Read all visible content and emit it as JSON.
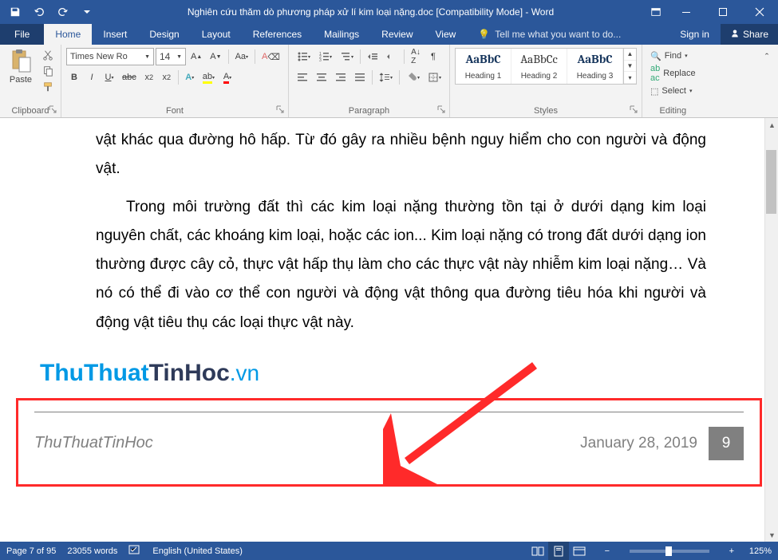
{
  "titlebar": {
    "title": "Nghiên cứu thăm dò phương pháp xử lí kim loại nặng.doc [Compatibility Mode] - Word"
  },
  "tabs": {
    "file": "File",
    "home": "Home",
    "insert": "Insert",
    "design": "Design",
    "layout": "Layout",
    "references": "References",
    "mailings": "Mailings",
    "review": "Review",
    "view": "View",
    "tellme": "Tell me what you want to do...",
    "signin": "Sign in",
    "share": "Share"
  },
  "ribbon": {
    "clipboard": {
      "label": "Clipboard",
      "paste": "Paste"
    },
    "font": {
      "label": "Font",
      "name": "Times New Ro",
      "size": "14"
    },
    "paragraph": {
      "label": "Paragraph"
    },
    "styles": {
      "label": "Styles",
      "items": [
        {
          "preview": "AaBbC",
          "name": "Heading 1"
        },
        {
          "preview": "AaBbCc",
          "name": "Heading 2"
        },
        {
          "preview": "AaBbC",
          "name": "Heading 3"
        }
      ]
    },
    "editing": {
      "label": "Editing",
      "find": "Find",
      "replace": "Replace",
      "select": "Select"
    }
  },
  "document": {
    "p1": "vật khác qua đường hô hấp. Từ đó gây ra nhiều bệnh nguy hiểm cho con người và động vật.",
    "p2": "Trong môi trường đất thì các kim loại nặng thường tồn tại ở dưới dạng kim loại nguyên chất, các khoáng kim loại, hoặc các ion... Kim loại nặng có trong đất dưới dạng ion thường được cây cỏ, thực vật hấp thụ làm cho các thực vật này nhiễm kim loại nặng… Và nó có thể đi vào cơ thể con người và động vật thông qua đường tiêu hóa khi người và động vật tiêu thụ các loại thực vật này.",
    "watermark": {
      "part1": "ThuThuat",
      "part2": "TinHoc",
      "ext": ".vn"
    },
    "footer": {
      "author": "ThuThuatTinHoc",
      "date": "January 28, 2019",
      "page": "9"
    }
  },
  "statusbar": {
    "page": "Page 7 of 95",
    "words": "23055 words",
    "lang": "English (United States)",
    "zoom": "125%"
  }
}
